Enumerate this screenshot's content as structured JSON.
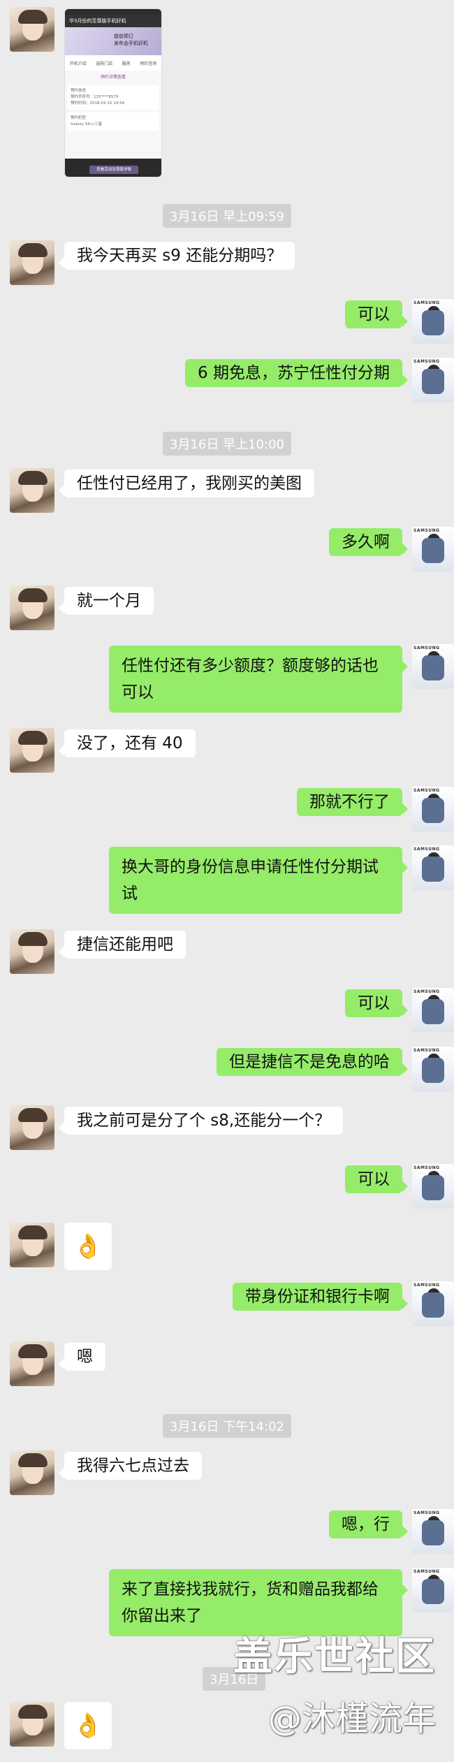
{
  "shared_image": {
    "nav_title": "华3月份的至尊版手机好机",
    "banner_line1": "提前预订",
    "banner_line2": "发布会手机好机",
    "icons": [
      "开机介绍",
      "选购门店",
      "服务",
      "预约咨询"
    ],
    "link": "预约详情查看",
    "panel1_title": "预约信息",
    "panel1_line1": "预约手机号：135****8579",
    "panel1_line2": "预约时间：2018-03-15 19:58",
    "panel2_title": "预约机型",
    "panel2_line1": "Galaxy S9+/三星",
    "button": "查看活动至尊版详情"
  },
  "timestamps": {
    "t1": "3月16日 早上09:59",
    "t2": "3月16日 早上10:00",
    "t3": "3月16日 下午14:02",
    "t4": "3月16日"
  },
  "avatar_brand": "SAMSUNG",
  "messages": {
    "m1": "我今天再买 s9 还能分期吗？",
    "m2": "可以",
    "m3": "6 期免息，苏宁任性付分期",
    "m4": "任性付已经用了，我刚买的美图",
    "m5": "多久啊",
    "m6": "就一个月",
    "m7a": "任性付还有多少额度？额度够的话也",
    "m7b": "可以",
    "m8": "没了，还有 40",
    "m9": "那就不行了",
    "m10a": "换大哥的身份信息申请任性付分期试",
    "m10b": "试",
    "m11": "捷信还能用吧",
    "m12": "可以",
    "m13": "但是捷信不是免息的哈",
    "m14": "我之前可是分了个 s8,还能分一个？",
    "m15": "可以",
    "m16": "👌",
    "m17": "带身份证和银行卡啊",
    "m18": "嗯",
    "m19": "我得六七点过去",
    "m20": "嗯，行",
    "m21a": "来了直接找我就行，货和赠品我都给",
    "m21b": "你留出来了",
    "m22": "👌"
  },
  "watermark": {
    "line1": "盖乐世社区",
    "line2": "@沐槿流年"
  }
}
